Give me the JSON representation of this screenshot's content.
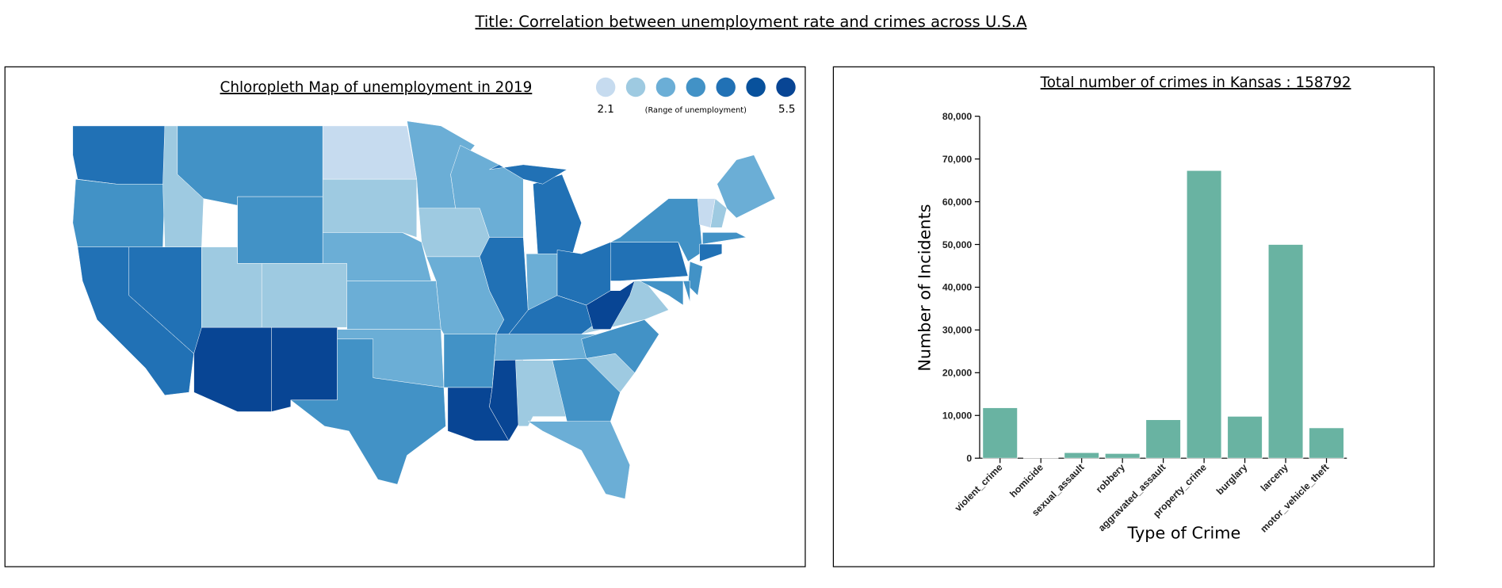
{
  "page_title": "Title: Correlation between unemployment rate and crimes across U.S.A",
  "map": {
    "title": "Chloropleth Map of unemployment in 2019",
    "legend": {
      "min_label": "2.1",
      "max_label": "5.5",
      "caption": "(Range of unemployment)",
      "colors": [
        "#c6dbef",
        "#9ecae1",
        "#6baed6",
        "#4292c6",
        "#2171b5",
        "#08519c",
        "#084594"
      ]
    },
    "state_color_levels": {
      "WA": 4,
      "OR": 3,
      "CA": 4,
      "NV": 4,
      "ID": 1,
      "MT": 3,
      "WY": 3,
      "UT": 1,
      "CO": 1,
      "AZ": 6,
      "NM": 6,
      "ND": 0,
      "SD": 1,
      "NE": 2,
      "KS": 2,
      "OK": 2,
      "TX": 3,
      "MN": 2,
      "IA": 1,
      "MO": 2,
      "AR": 3,
      "LA": 6,
      "WI": 2,
      "IL": 4,
      "MS": 6,
      "MI": 4,
      "IN": 2,
      "KY": 4,
      "TN": 2,
      "AL": 1,
      "GA": 3,
      "FL": 2,
      "SC": 1,
      "NC": 3,
      "VA": 1,
      "WV": 6,
      "OH": 4,
      "PA": 4,
      "NY": 3,
      "ME": 2,
      "VT": 0,
      "NH": 1,
      "MA": 3,
      "CT": 4,
      "NJ": 3,
      "MD": 3,
      "DE": 3
    }
  },
  "chart_data": {
    "type": "bar",
    "title": "Total number of crimes in Kansas : 158792",
    "xlabel": "Type of Crime",
    "ylabel": "Number of Incidents",
    "categories": [
      "violent_crime",
      "homicide",
      "sexual_assault",
      "robbery",
      "aggravated_assault",
      "property_crime",
      "burglary",
      "larceny",
      "motor_vehicle_theft"
    ],
    "values": [
      11800,
      100,
      1300,
      1100,
      9000,
      67300,
      9800,
      50000,
      7100
    ],
    "ylim": [
      0,
      80000
    ],
    "yticks": [
      "0",
      "10,000",
      "20,000",
      "30,000",
      "40,000",
      "50,000",
      "60,000",
      "70,000",
      "80,000"
    ],
    "bar_color": "#69b3a2",
    "grid": false
  }
}
